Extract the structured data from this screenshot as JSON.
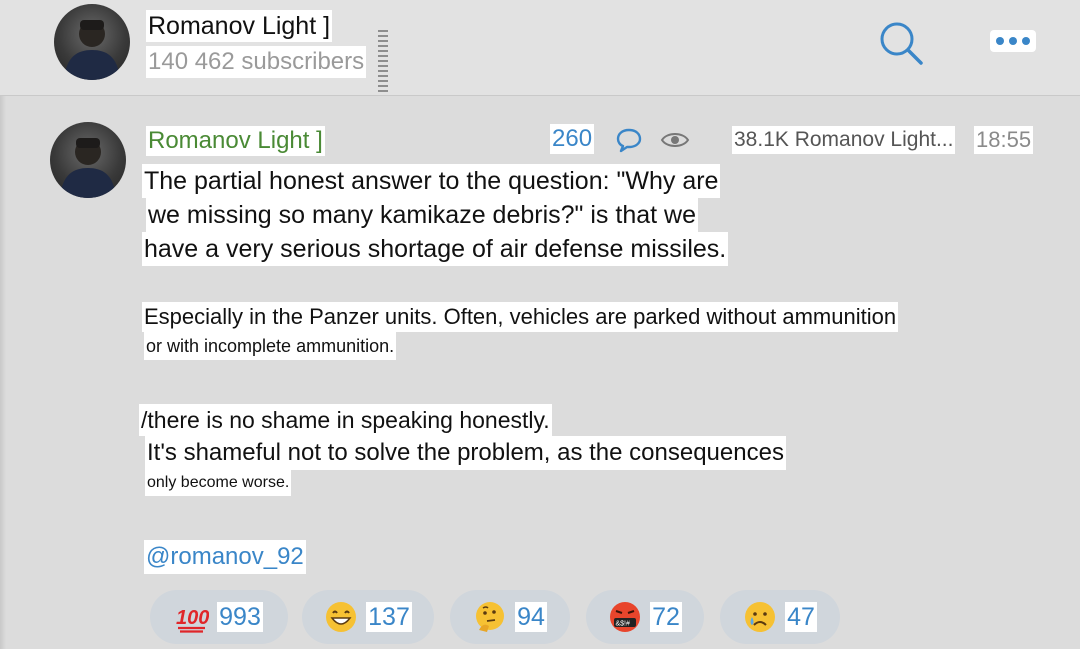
{
  "header": {
    "channel_name": "Romanov Light ]",
    "subscribers": "140 462 subscribers"
  },
  "post": {
    "author": "Romanov Light ]",
    "comments_count": "260",
    "views_and_signature": "38.1K Romanov Light...",
    "time": "18:55",
    "paragraph1": [
      "The partial honest answer to the question: \"Why are",
      "we missing so many kamikaze debris?\" is that we",
      "have a very serious shortage of air defense missiles."
    ],
    "paragraph2": [
      "Especially in the Panzer units. Often, vehicles are parked without ammunition",
      "or with incomplete ammunition."
    ],
    "paragraph3": [
      "/there is no shame in speaking honestly.",
      "It's shameful not to solve the problem, as the consequences",
      "only become worse."
    ],
    "handle": "@romanov_92"
  },
  "reactions": [
    {
      "emoji": "hundred-points",
      "count": "993"
    },
    {
      "emoji": "grinning-face",
      "count": "137"
    },
    {
      "emoji": "thinking-face",
      "count": "94"
    },
    {
      "emoji": "cursing-face",
      "count": "72"
    },
    {
      "emoji": "crying-face",
      "count": "47"
    }
  ],
  "colors": {
    "accent": "#3a86c8",
    "author": "#4a8a35",
    "background": "#dcdcdc"
  }
}
